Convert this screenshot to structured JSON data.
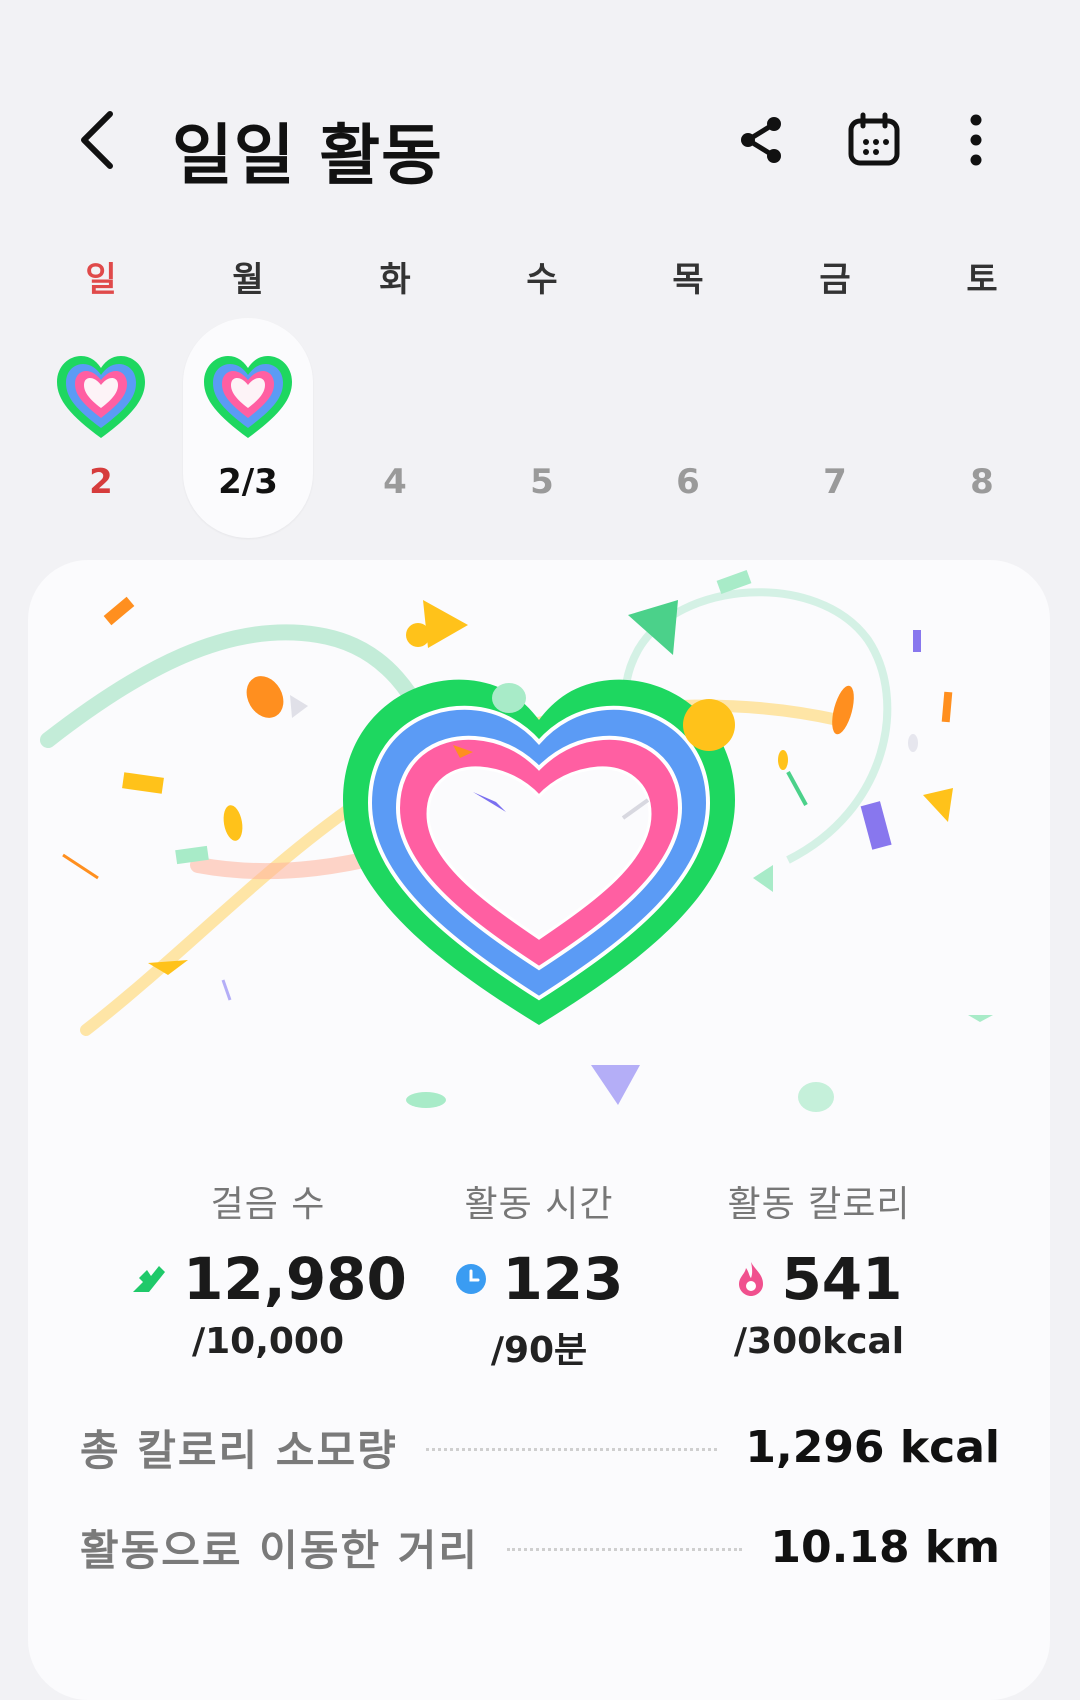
{
  "header": {
    "title": "일일 활동",
    "icons": [
      "back-icon",
      "share-icon",
      "calendar-icon",
      "more-icon"
    ]
  },
  "week": {
    "days": [
      {
        "dow": "일",
        "date": "2",
        "has_heart": true
      },
      {
        "dow": "월",
        "date": "2/3",
        "has_heart": true,
        "selected": true
      },
      {
        "dow": "화",
        "date": "4"
      },
      {
        "dow": "수",
        "date": "5"
      },
      {
        "dow": "목",
        "date": "6"
      },
      {
        "dow": "금",
        "date": "7"
      },
      {
        "dow": "토",
        "date": "8"
      }
    ]
  },
  "stats": {
    "steps": {
      "label": "걸음 수",
      "value": "12,980",
      "goal": "/10,000",
      "icon": "shoe-icon",
      "color": "#1fc96a"
    },
    "active_time": {
      "label": "활동 시간",
      "value": "123",
      "goal": "/90분",
      "icon": "clock-icon",
      "color": "#3a9cf2"
    },
    "active_calories": {
      "label": "활동 칼로리",
      "value": "541",
      "goal": "/300kcal",
      "icon": "flame-icon",
      "color": "#f0508e"
    }
  },
  "summary": {
    "total_calories": {
      "label": "총 칼로리 소모량",
      "value": "1,296 kcal"
    },
    "distance": {
      "label": "활동으로 이동한 거리",
      "value": "10.18 km"
    }
  },
  "colors": {
    "ring_outer": "#1ed760",
    "ring_middle": "#5b9bf5",
    "ring_inner": "#ff5fa2"
  }
}
